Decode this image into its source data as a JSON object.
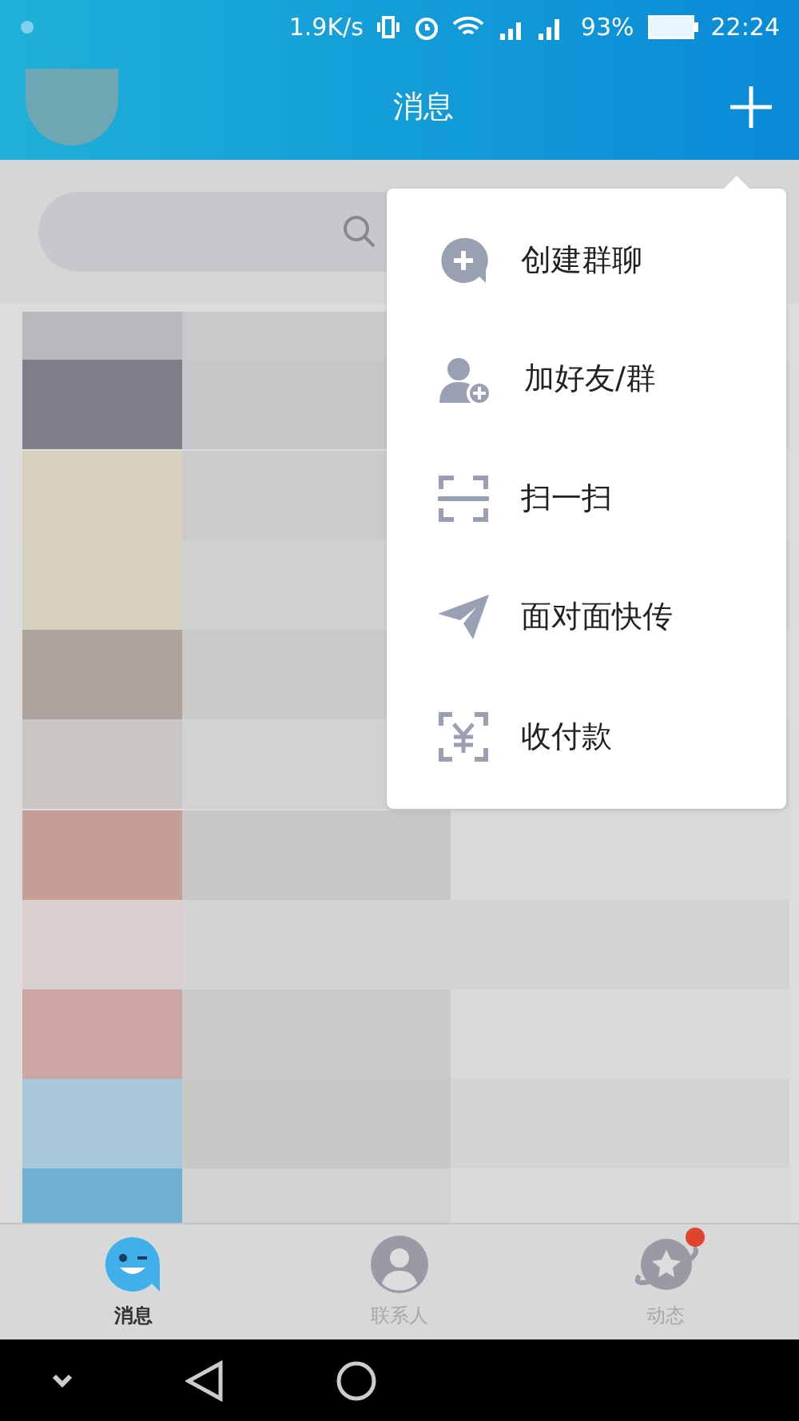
{
  "status_bar": {
    "speed": "1.9K/s",
    "battery": "93%",
    "time": "22:24"
  },
  "header": {
    "title": "消息"
  },
  "menu": {
    "items": [
      {
        "kind": "group-chat",
        "label": "创建群聊"
      },
      {
        "kind": "add-friend",
        "label": "加好友/群"
      },
      {
        "kind": "scan",
        "label": "扫一扫"
      },
      {
        "kind": "send",
        "label": "面对面快传"
      },
      {
        "kind": "payment",
        "label": "收付款"
      }
    ]
  },
  "tabs": [
    {
      "kind": "messages",
      "label": "消息",
      "selected": true,
      "badge": false
    },
    {
      "kind": "contacts",
      "label": "联系人",
      "selected": false,
      "badge": false
    },
    {
      "kind": "feed",
      "label": "动态",
      "selected": false,
      "badge": true
    }
  ]
}
